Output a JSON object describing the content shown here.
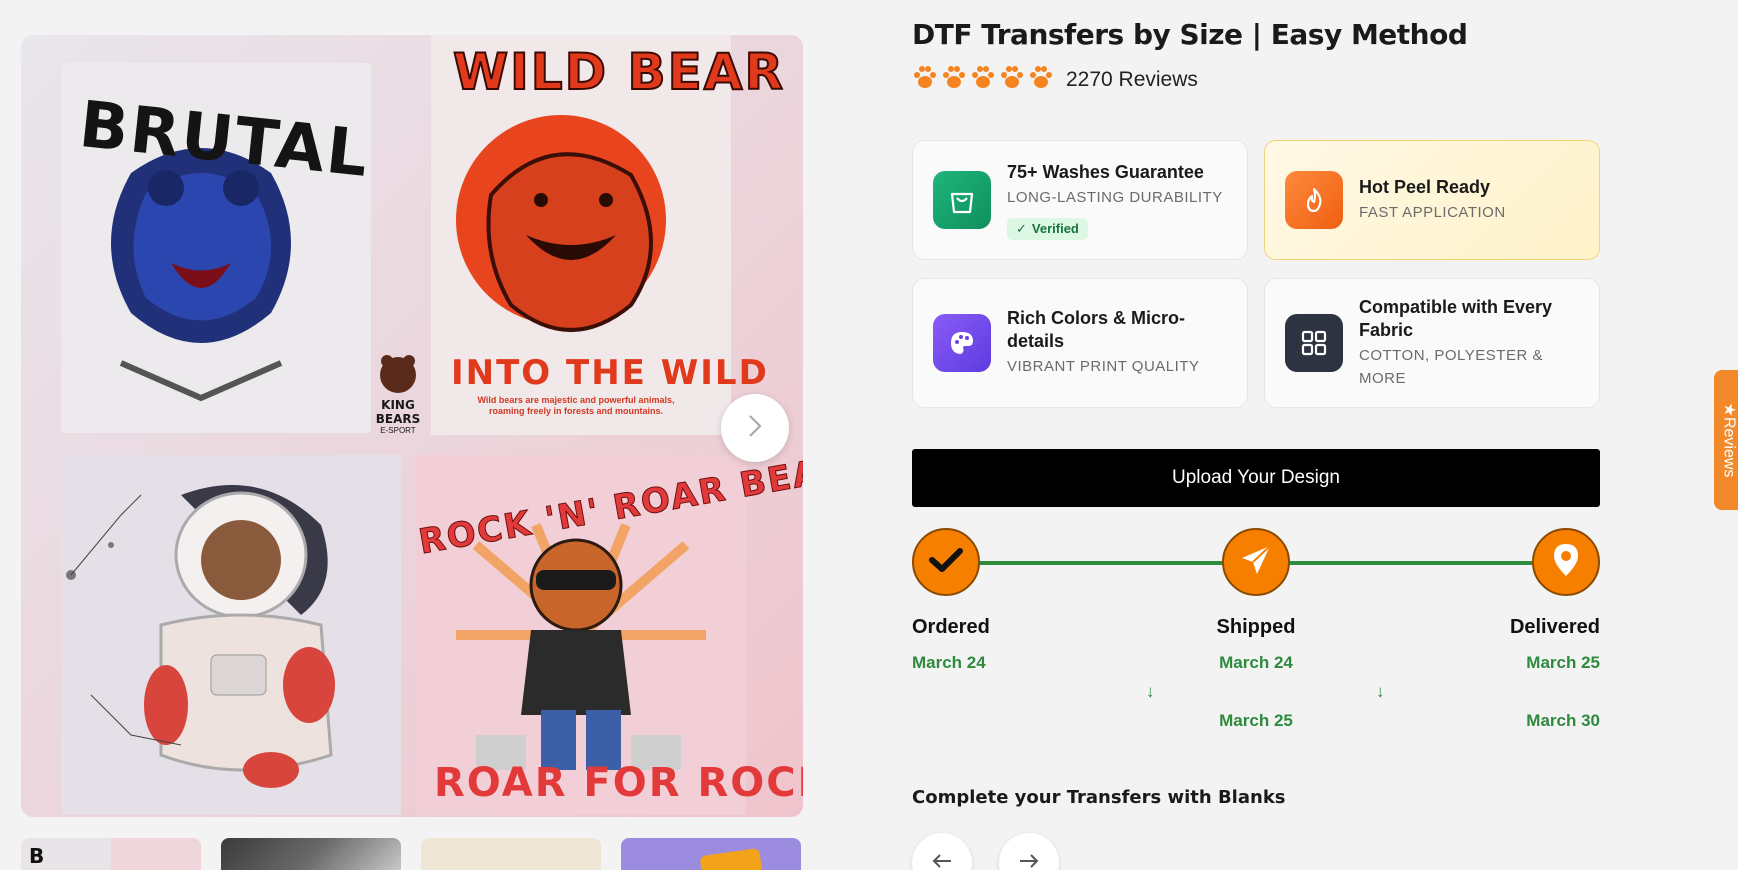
{
  "product": {
    "title": "DTF Transfers by Size | Easy Method",
    "reviews": "2270 Reviews",
    "rating_stars": 5
  },
  "gallery": {
    "art": {
      "brutal": "BRUTAL",
      "wild_bear": "WILD BEAR",
      "into_the_wild": "INTO THE WILD",
      "into_the_wild_caption": "Wild bears are majestic and powerful animals, roaming freely in forests and mountains.",
      "king_bears": "KING BEARS",
      "e_sport": "E-SPORT",
      "rock_n_roar": "ROCK 'N' ROAR BEAR",
      "roar_for_rock": "ROAR FOR ROCK"
    },
    "thumbnails": 4
  },
  "features": [
    {
      "title": "75+ Washes Guarantee",
      "subtitle": "LONG-LASTING DURABILITY",
      "badge": "Verified",
      "icon": "shopping-bag-icon",
      "color": "#16a06b"
    },
    {
      "title": "Hot Peel Ready",
      "subtitle": "FAST APPLICATION",
      "icon": "flame-icon",
      "color": "#f26b1d"
    },
    {
      "title": "Rich Colors & Micro-details",
      "subtitle": "VIBRANT PRINT QUALITY",
      "icon": "palette-icon",
      "color": "#7a4cf0"
    },
    {
      "title": "Compatible with Every Fabric",
      "subtitle": "COTTON, POLYESTER & MORE",
      "icon": "grid-icon",
      "color": "#2d3340"
    }
  ],
  "upload_label": "Upload Your Design",
  "tracking": {
    "steps": [
      {
        "label": "Ordered",
        "date": "March 24"
      },
      {
        "label": "Shipped",
        "date_from": "March 24",
        "date_to": "March 25"
      },
      {
        "label": "Delivered",
        "date_from": "March 25",
        "date_to": "March 30"
      }
    ],
    "arrow": "↓",
    "accent": "#2e8b3e",
    "dot_color": "#f77f00"
  },
  "blanks_title": "Complete your Transfers with Blanks",
  "reviews_tab": "★Reviews"
}
